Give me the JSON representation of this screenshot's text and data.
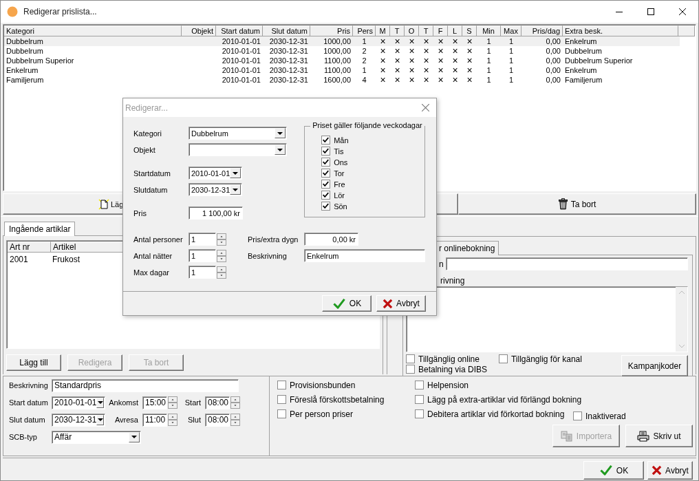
{
  "window": {
    "title": "Redigerar prislista..."
  },
  "price_table": {
    "columns": [
      "Kategori",
      "Objekt",
      "Start datum",
      "Slut datum",
      "Pris",
      "Pers",
      "M",
      "T",
      "O",
      "T",
      "F",
      "L",
      "S",
      "Min",
      "Max",
      "Pris/dag",
      "Extra besk."
    ],
    "rows": [
      {
        "kategori": "Dubbelrum",
        "start": "2010-01-01",
        "slut": "2030-12-31",
        "pris": "1000,00",
        "pers": "1",
        "days": [
          "×",
          "×",
          "×",
          "×",
          "×",
          "×",
          "×"
        ],
        "min": "1",
        "max": "1",
        "pris_dag": "0,00",
        "extra": "Enkelrum",
        "selected": true
      },
      {
        "kategori": "Dubbelrum",
        "start": "2010-01-01",
        "slut": "2030-12-31",
        "pris": "1000,00",
        "pers": "2",
        "days": [
          "×",
          "×",
          "×",
          "×",
          "×",
          "×",
          "×"
        ],
        "min": "1",
        "max": "1",
        "pris_dag": "0,00",
        "extra": "Dubbelrum",
        "selected": false
      },
      {
        "kategori": "Dubbelrum Superior",
        "start": "2010-01-01",
        "slut": "2030-12-31",
        "pris": "1100,00",
        "pers": "2",
        "days": [
          "×",
          "×",
          "×",
          "×",
          "×",
          "×",
          "×"
        ],
        "min": "1",
        "max": "1",
        "pris_dag": "0,00",
        "extra": "Dubbelrum Superior",
        "selected": false
      },
      {
        "kategori": "Enkelrum",
        "start": "2010-01-01",
        "slut": "2030-12-31",
        "pris": "1100,00",
        "pers": "1",
        "days": [
          "×",
          "×",
          "×",
          "×",
          "×",
          "×",
          "×"
        ],
        "min": "1",
        "max": "1",
        "pris_dag": "0,00",
        "extra": "Enkelrum",
        "selected": false
      },
      {
        "kategori": "Familjerum",
        "start": "2010-01-01",
        "slut": "2030-12-31",
        "pris": "1600,00",
        "pers": "4",
        "days": [
          "×",
          "×",
          "×",
          "×",
          "×",
          "×",
          "×"
        ],
        "min": "1",
        "max": "1",
        "pris_dag": "0,00",
        "extra": "Familjerum",
        "selected": false
      }
    ]
  },
  "table_buttons": [
    {
      "label": "Läg",
      "kind": "add"
    },
    {
      "kind": "edit"
    },
    {
      "label": "Ta bort",
      "kind": "delete"
    }
  ],
  "articles": {
    "tab": {
      "label": "Ingående artiklar",
      "selected": true
    },
    "columns": [
      "Art nr",
      "Artikel"
    ],
    "rows": [
      [
        "2001",
        "Frukost"
      ]
    ],
    "buttons": [
      {
        "label": "Lägg till",
        "disabled": false
      },
      {
        "label": "Redigera",
        "disabled": true
      },
      {
        "label": "Ta bort",
        "disabled": true
      }
    ]
  },
  "online": {
    "tab": {
      "label": "r onlinebokning",
      "selected": true
    },
    "name_label": "n",
    "description_label": "rivning",
    "checkboxes": [
      {
        "label": "Tillgänglig online",
        "checked": false
      },
      {
        "label": "Tillgänglig för kanal",
        "checked": false
      },
      {
        "label": "Betalning via DIBS",
        "checked": false
      }
    ],
    "button": "Kampanjkoder"
  },
  "settings": {
    "description": {
      "label": "Beskrivning",
      "value": "Standardpris"
    },
    "start_date": {
      "label": "Start datum",
      "value": "2010-01-01"
    },
    "arrival": {
      "label": "Ankomst",
      "value": "15:00"
    },
    "start": {
      "label": "Start",
      "value": "08:00"
    },
    "end_date": {
      "label": "Slut datum",
      "value": "2030-12-31"
    },
    "departure": {
      "label": "Avresa",
      "value": "11:00"
    },
    "end": {
      "label": "Slut",
      "value": "08:00"
    },
    "scb_type": {
      "label": "SCB-typ",
      "value": "Affär"
    },
    "options_left": [
      {
        "label": "Provisionsbunden",
        "checked": false
      },
      {
        "label": "Föreslå förskottsbetalning",
        "checked": false
      },
      {
        "label": "Per person priser",
        "checked": false
      }
    ],
    "options_right": [
      {
        "label": "Helpension",
        "checked": false
      },
      {
        "label": "Lägg på extra-artiklar vid förlängd bokning",
        "checked": false
      },
      {
        "label": "Debitera artiklar vid förkortad bokning",
        "checked": false
      }
    ],
    "inactive": {
      "label": "Inaktiverad",
      "checked": false
    },
    "buttons": [
      {
        "label": "Importera",
        "kind": "import",
        "disabled": true
      },
      {
        "label": "Skriv ut",
        "kind": "print",
        "disabled": false
      }
    ]
  },
  "footer_buttons": [
    {
      "label": "OK",
      "kind": "ok"
    },
    {
      "label": "Avbryt",
      "kind": "cancel"
    }
  ],
  "dialog": {
    "title": "Redigerar...",
    "category": {
      "label": "Kategori",
      "value": "Dubbelrum"
    },
    "object": {
      "label": "Objekt"
    },
    "start_date": {
      "label": "Startdatum",
      "value": "2010-01-01"
    },
    "end_date": {
      "label": "Slutdatum",
      "value": "2030-12-31"
    },
    "price": {
      "label": "Pris",
      "value": "1 100,00 kr"
    },
    "persons": {
      "label": "Antal personer",
      "value": "1"
    },
    "nights": {
      "label": "Antal nätter",
      "value": "1"
    },
    "max_days": {
      "label": "Max dagar",
      "value": "1"
    },
    "extra_price": {
      "label": "Pris/extra dygn",
      "value": "0,00 kr"
    },
    "description": {
      "label": "Beskrivning",
      "value": "Enkelrum"
    },
    "weekdays": {
      "title": "Priset gäller följande veckodagar",
      "days": [
        {
          "label": "Mån",
          "checked": true
        },
        {
          "label": "Tis",
          "checked": true
        },
        {
          "label": "Ons",
          "checked": true
        },
        {
          "label": "Tor",
          "checked": true
        },
        {
          "label": "Fre",
          "checked": true
        },
        {
          "label": "Lör",
          "checked": true
        },
        {
          "label": "Sön",
          "checked": true
        }
      ]
    },
    "buttons": [
      {
        "label": "OK",
        "kind": "ok"
      },
      {
        "label": "Avbryt",
        "kind": "cancel"
      }
    ]
  }
}
